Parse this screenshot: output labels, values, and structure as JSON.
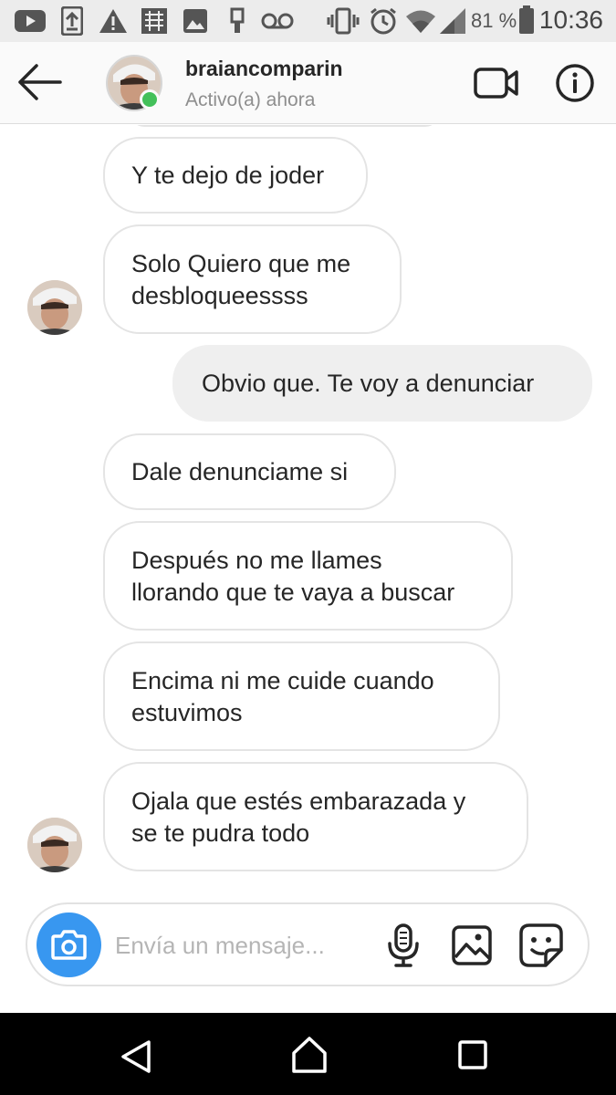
{
  "status_bar": {
    "icons": [
      "youtube-icon",
      "upload-icon",
      "warning-icon",
      "cast-icon",
      "image-icon",
      "usb-icon",
      "voicemail-icon",
      "vibrate-icon",
      "alarm-icon",
      "wifi-icon",
      "signal-icon",
      "battery-icon"
    ],
    "battery": "81 %",
    "time": "10:36"
  },
  "header": {
    "username": "braiancomparin",
    "presence": "Activo(a) ahora",
    "icons": {
      "back": "back-arrow-icon",
      "video": "video-camera-icon",
      "info": "info-icon"
    },
    "online_color": "#43c05a"
  },
  "messages": [
    {
      "text": "Y te dejo de joder",
      "direction": "incoming"
    },
    {
      "text": "Solo Quiero que me\ndesbloqueessss",
      "direction": "incoming"
    },
    {
      "text": "Obvio que. Te voy a denunciar",
      "direction": "outgoing"
    },
    {
      "text": "Dale denunciame si",
      "direction": "incoming"
    },
    {
      "text": "Después no me llames\nllorando que te vaya a buscar",
      "direction": "incoming"
    },
    {
      "text": "Encima ni me cuide cuando\nestuvimos",
      "direction": "incoming"
    },
    {
      "text": "Ojala que estés embarazada y\nse te pudra todo",
      "direction": "incoming"
    }
  ],
  "composer": {
    "placeholder": "Envía un mensaje...",
    "value": "",
    "icons": [
      "camera-icon",
      "microphone-icon",
      "gallery-icon",
      "sticker-icon"
    ],
    "accent": "#3897f0"
  },
  "nav_bar": {
    "icons": [
      "nav-back-icon",
      "nav-home-icon",
      "nav-recents-icon"
    ]
  }
}
